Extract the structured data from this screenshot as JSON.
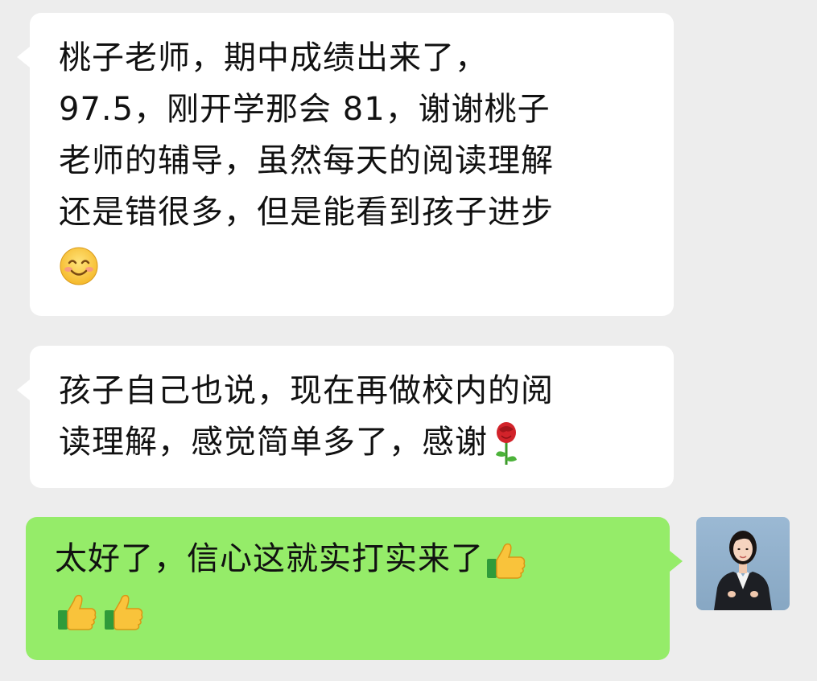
{
  "messages": [
    {
      "direction": "incoming",
      "lines": [
        "桃子老师，期中成绩出来了，",
        "97.5，刚开学那会 81，谢谢桃子",
        "老师的辅导，虽然每天的阅读理解",
        "还是错很多，但是能看到孩子进步"
      ],
      "trailing_emoji": "smiling-face-icon"
    },
    {
      "direction": "incoming",
      "lines": [
        "孩子自己也说，现在再做校内的阅",
        "读理解，感觉简单多了，感谢"
      ],
      "trailing_emoji": "rose-icon"
    },
    {
      "direction": "outgoing",
      "lines": [
        "太好了，信心这就实打实来了"
      ],
      "trailing_emoji": "thumbs-up-icon",
      "extra_emojis": [
        "thumbs-up-icon",
        "thumbs-up-icon"
      ]
    }
  ],
  "colors": {
    "background": "#ededed",
    "incoming_bubble": "#ffffff",
    "outgoing_bubble": "#95ec69",
    "text": "#111111"
  },
  "avatar": {
    "description_icon": "user-avatar-photo"
  }
}
